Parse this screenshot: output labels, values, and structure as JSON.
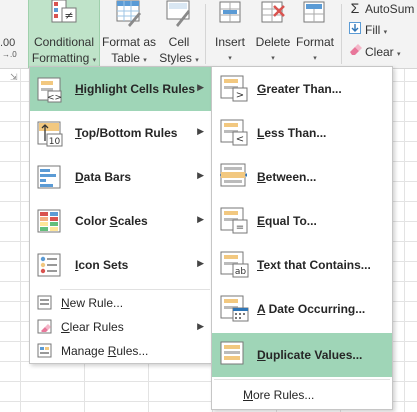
{
  "ribbon": {
    "zero_text": ".00",
    "left_arrows": "→.0",
    "launcher": "⇲",
    "conditional_formatting": {
      "line1": "Conditional",
      "line2_pre": "",
      "line2_ul": "",
      "line2_post": "Formatting"
    },
    "format_as_table": {
      "line1": "Format as",
      "line2": "Table"
    },
    "cell_styles": {
      "line1": "Cell",
      "line2": "Styles"
    },
    "insert": "Insert",
    "delete": "Delete",
    "format": "Format",
    "autosum": "AutoSum",
    "fill": "Fill",
    "clear": "Clear",
    "caret": "▾",
    "sigma": "Σ"
  },
  "main_menu": {
    "items": [
      {
        "ul": "H",
        "rest": "ighlight Cells Rules",
        "highlighted": true,
        "has_submenu": true
      },
      {
        "ul": "T",
        "rest": "op/Bottom Rules",
        "has_submenu": true
      },
      {
        "ul": "D",
        "rest": "ata Bars",
        "has_submenu": true
      },
      {
        "ul": "",
        "pre": "Color ",
        "ul2": "S",
        "rest": "cales",
        "has_submenu": true
      },
      {
        "ul": "I",
        "rest": "con Sets",
        "has_submenu": true
      }
    ],
    "small_items": [
      {
        "ul": "N",
        "rest": "ew Rule..."
      },
      {
        "ul": "C",
        "rest": "lear Rules",
        "has_submenu": true
      },
      {
        "pre": "Manage ",
        "ul": "R",
        "rest": "ules..."
      }
    ],
    "arrow": "▶",
    "topbottom_icon_text": "10"
  },
  "sub_menu": {
    "items": [
      {
        "ul": "G",
        "rest": "reater Than..."
      },
      {
        "ul": "L",
        "rest": "ess Than..."
      },
      {
        "ul": "B",
        "rest": "etween..."
      },
      {
        "ul": "E",
        "rest": "qual To..."
      },
      {
        "ul": "T",
        "rest": "ext that Contains..."
      },
      {
        "ul": "A",
        "rest": " Date Occurring..."
      },
      {
        "ul": "D",
        "rest": "uplicate Values...",
        "highlighted": true
      }
    ],
    "more": {
      "ul": "M",
      "rest": "ore Rules..."
    },
    "icon_text": {
      "greater": ">",
      "less": "<",
      "equal": "=",
      "text": "ab"
    }
  },
  "colors": {
    "highlight": "#9fd5b7",
    "ribbon_active": "#bfe3c9",
    "excel_green": "#217346",
    "rule_orange": "#f2c880"
  }
}
